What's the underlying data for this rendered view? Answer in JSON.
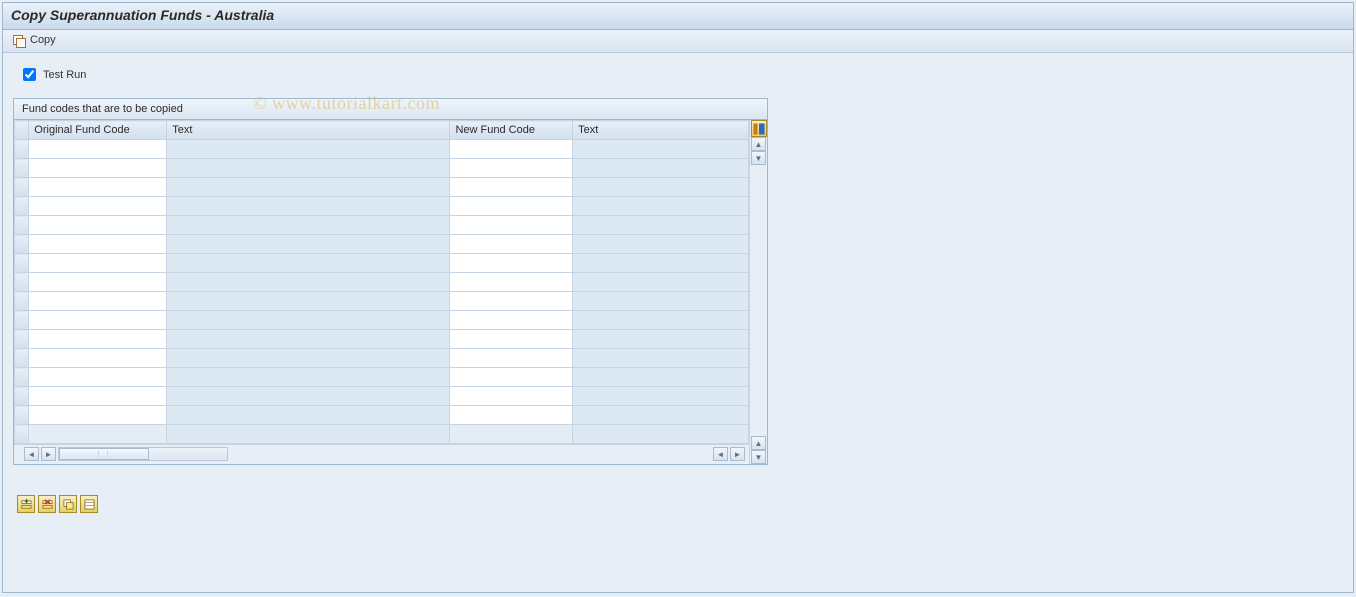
{
  "header": {
    "title": "Copy Superannuation Funds - Australia"
  },
  "toolbar": {
    "copy_label": "Copy"
  },
  "options": {
    "test_run_label": "Test Run",
    "test_run_checked": true
  },
  "group": {
    "title": "Fund codes that are to be copied",
    "columns": {
      "original_fund_code": "Original Fund Code",
      "text1": "Text",
      "new_fund_code": "New Fund Code",
      "text2": "Text"
    },
    "rows": [
      {
        "ofc": "",
        "t1": "",
        "nfc": "",
        "t2": ""
      },
      {
        "ofc": "",
        "t1": "",
        "nfc": "",
        "t2": ""
      },
      {
        "ofc": "",
        "t1": "",
        "nfc": "",
        "t2": ""
      },
      {
        "ofc": "",
        "t1": "",
        "nfc": "",
        "t2": ""
      },
      {
        "ofc": "",
        "t1": "",
        "nfc": "",
        "t2": ""
      },
      {
        "ofc": "",
        "t1": "",
        "nfc": "",
        "t2": ""
      },
      {
        "ofc": "",
        "t1": "",
        "nfc": "",
        "t2": ""
      },
      {
        "ofc": "",
        "t1": "",
        "nfc": "",
        "t2": ""
      },
      {
        "ofc": "",
        "t1": "",
        "nfc": "",
        "t2": ""
      },
      {
        "ofc": "",
        "t1": "",
        "nfc": "",
        "t2": ""
      },
      {
        "ofc": "",
        "t1": "",
        "nfc": "",
        "t2": ""
      },
      {
        "ofc": "",
        "t1": "",
        "nfc": "",
        "t2": ""
      },
      {
        "ofc": "",
        "t1": "",
        "nfc": "",
        "t2": ""
      },
      {
        "ofc": "",
        "t1": "",
        "nfc": "",
        "t2": ""
      },
      {
        "ofc": "",
        "t1": "",
        "nfc": "",
        "t2": ""
      },
      {
        "ofc": "",
        "t1": "",
        "nfc": "",
        "t2": ""
      }
    ]
  },
  "watermark": "© www.tutorialkart.com",
  "footer_buttons": [
    "insert-row",
    "delete-row",
    "copy-row",
    "select-all"
  ]
}
